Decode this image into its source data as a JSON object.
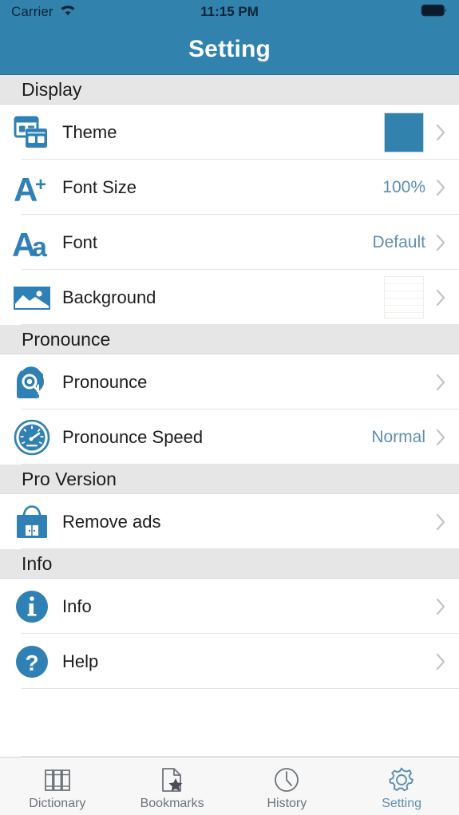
{
  "status_bar": {
    "carrier": "Carrier",
    "wifi_icon": "wifi-icon",
    "time": "11:15 PM",
    "battery_icon": "battery-full-icon"
  },
  "nav_bar": {
    "title": "Setting"
  },
  "theme_colors": {
    "brand_blue": "#3182ad",
    "accent_value_text": "#5d8eae",
    "section_header_bg": "#e6e6e6",
    "row_bg": "#ffffff",
    "separator": "#e4e4e4",
    "tabbar_bg": "#f7f7f7",
    "tab_inactive": "#6d7379",
    "tab_active": "#5d8eae"
  },
  "sections": [
    {
      "header": "Display",
      "rows": [
        {
          "label": "Theme",
          "icon": "theme-windows-icon",
          "accessory": "color-swatch",
          "swatch_color": "#3182ad",
          "value": "",
          "chevron": true
        },
        {
          "label": "Font Size",
          "icon": "font-size-a-plus-icon",
          "accessory": "text",
          "value": "100%",
          "chevron": true
        },
        {
          "label": "Font",
          "icon": "font-aa-icon",
          "accessory": "text",
          "value": "Default",
          "chevron": true
        },
        {
          "label": "Background",
          "icon": "background-picture-icon",
          "accessory": "paper-swatch",
          "value": "",
          "chevron": true
        }
      ]
    },
    {
      "header": "Pronounce",
      "rows": [
        {
          "label": "Pronounce",
          "icon": "pronounce-headset-head-icon",
          "accessory": "none",
          "value": "",
          "chevron": true
        },
        {
          "label": "Pronounce Speed",
          "icon": "speedometer-icon",
          "accessory": "text",
          "value": "Normal",
          "chevron": true
        }
      ]
    },
    {
      "header": "Pro Version",
      "rows": [
        {
          "label": "Remove ads",
          "icon": "shopping-bag-icon",
          "accessory": "none",
          "value": "",
          "chevron": true
        }
      ]
    },
    {
      "header": "Info",
      "rows": [
        {
          "label": "Info",
          "icon": "info-circle-icon",
          "accessory": "none",
          "value": "",
          "chevron": true
        },
        {
          "label": "Help",
          "icon": "question-circle-icon",
          "accessory": "none",
          "value": "",
          "chevron": true
        }
      ]
    }
  ],
  "tab_bar": {
    "items": [
      {
        "label": "Dictionary",
        "icon": "books-icon",
        "active": false
      },
      {
        "label": "Bookmarks",
        "icon": "page-star-icon",
        "active": false
      },
      {
        "label": "History",
        "icon": "clock-icon",
        "active": false
      },
      {
        "label": "Setting",
        "icon": "gear-icon",
        "active": true
      }
    ]
  }
}
